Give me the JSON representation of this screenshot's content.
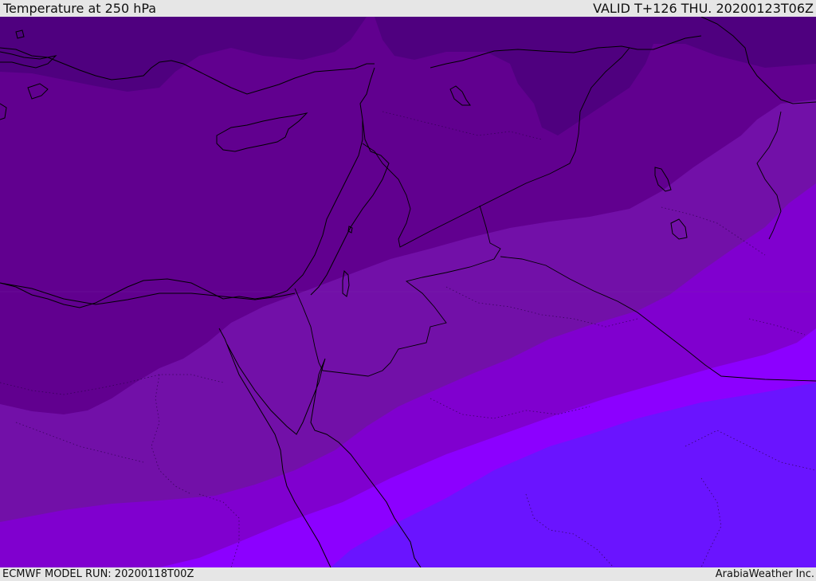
{
  "header": {
    "title": "Temperature at 250 hPa",
    "valid_time": "VALID T+126 THU. 20200123T06Z"
  },
  "footer": {
    "model_run": "ECMWF MODEL RUN: 20200118T00Z",
    "credit": "ArabiaWeather Inc."
  },
  "map": {
    "parameter": "temperature",
    "level": "250 hPa",
    "region": "Eastern Mediterranean, Levant and northern Red Sea",
    "colors": {
      "band_darkest": "#4f007f",
      "band_dark": "#61008f",
      "band_mid": "#7210a8",
      "band_violet": "#8000cf",
      "band_bright_violet": "#8c00ff",
      "band_blue_violet": "#6a14ff",
      "coastline": "#000000",
      "border": "#000000"
    }
  }
}
